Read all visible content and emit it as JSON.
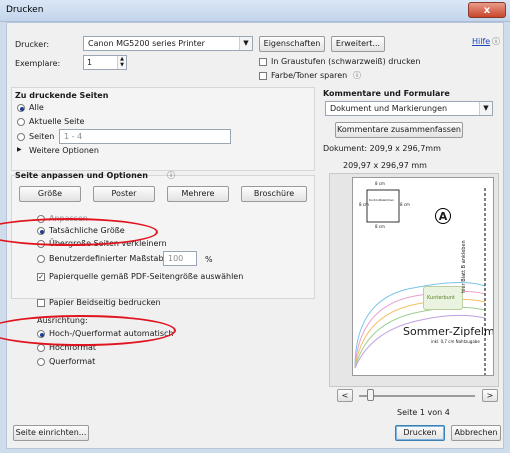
{
  "window": {
    "title": "Drucken",
    "close_glyph": "x"
  },
  "printer": {
    "label": "Drucker:",
    "value": "Canon MG5200 series Printer",
    "properties_button": "Eigenschaften",
    "advanced_button": "Erweitert...",
    "help_link": "Hilfe"
  },
  "copies": {
    "label": "Exemplare:",
    "value": "1"
  },
  "options": {
    "grayscale": {
      "label": "In Graustufen (schwarzweiß) drucken",
      "checked": false
    },
    "save_ink": {
      "label": "Farbe/Toner sparen",
      "checked": false
    }
  },
  "pages": {
    "heading": "Zu druckende Seiten",
    "all": "Alle",
    "current": "Aktuelle Seite",
    "range": "Seiten",
    "range_value": "1 - 4",
    "more": "Weitere Optionen"
  },
  "sizing": {
    "heading": "Seite anpassen und Optionen",
    "tabs": [
      "Größe",
      "Poster",
      "Mehrere",
      "Broschüre"
    ],
    "fit": "Anpassen",
    "actual": "Tatsächliche Größe",
    "shrink": "Übergroße Seiten verkleinern",
    "custom": "Benutzerdefinierter Maßstab:",
    "custom_value": "100",
    "percent": "%",
    "paper_source": "Papierquelle gemäß PDF-Seitengröße auswählen"
  },
  "duplex": {
    "label": "Papier Beidseitig bedrucken"
  },
  "orientation": {
    "heading": "Ausrichtung:",
    "auto": "Hoch-/Querformat automatisch",
    "portrait": "Hochformat",
    "landscape": "Querformat"
  },
  "comments": {
    "heading": "Kommentare und Formulare",
    "value": "Dokument und Markierungen",
    "summarize_button": "Kommentare zusammenfassen"
  },
  "document": {
    "label": "Dokument: 209,9 x 296,7mm",
    "preview_size": "209,97 x 296,97 mm"
  },
  "preview": {
    "measure_top": "8 cm",
    "measure_side": "8 cm",
    "measure_side2": "8 cm",
    "measure_bottom": "8 cm",
    "box_label": "Kontrollkästchen",
    "circle_letter": "A",
    "side_text": "hier Blatt B ankleben",
    "title": "Sommer-Zipfelmüt",
    "subtitle": "inkl. 0,7 cm Nahtzugabe",
    "logo_text": "Kunterbunt"
  },
  "pager": {
    "prev": "<",
    "next": ">",
    "status": "Seite 1 von 4"
  },
  "footer": {
    "setup_button": "Seite einrichten...",
    "print_button": "Drucken",
    "cancel_button": "Abbrechen"
  },
  "colors": {
    "annotation": "#e0141e",
    "accent": "#1a44b8"
  }
}
